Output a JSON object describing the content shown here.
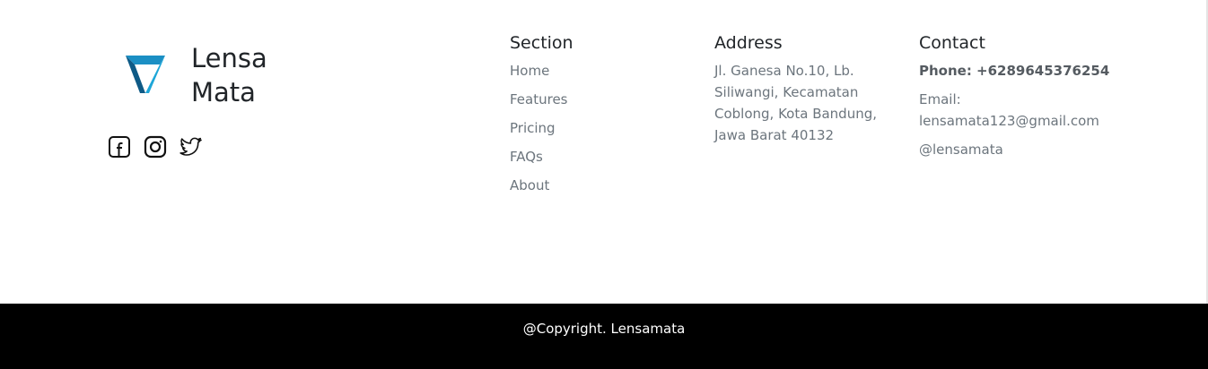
{
  "brand": {
    "name_line1": "Lensa",
    "name_line2": "Mata",
    "logo_icon": "lensa-mata-logo",
    "colors": {
      "logo_dark": "#0e5a86",
      "logo_light": "#1da6d8"
    }
  },
  "socials": [
    {
      "icon": "facebook-icon"
    },
    {
      "icon": "instagram-icon"
    },
    {
      "icon": "twitter-icon"
    }
  ],
  "section": {
    "title": "Section",
    "links": [
      {
        "label": "Home"
      },
      {
        "label": "Features"
      },
      {
        "label": "Pricing"
      },
      {
        "label": "FAQs"
      },
      {
        "label": "About"
      }
    ]
  },
  "address": {
    "title": "Address",
    "text": "Jl. Ganesa No.10, Lb. Siliwangi, Kecamatan Coblong, Kota Bandung, Jawa Barat 40132"
  },
  "contact": {
    "title": "Contact",
    "phone": "Phone: +6289645376254",
    "email_label": "Email:",
    "email": "lensamata123@gmail.com",
    "handle": "@lensamata"
  },
  "footer": {
    "copyright": "@Copyright. Lensamata",
    "background": "#000000"
  }
}
